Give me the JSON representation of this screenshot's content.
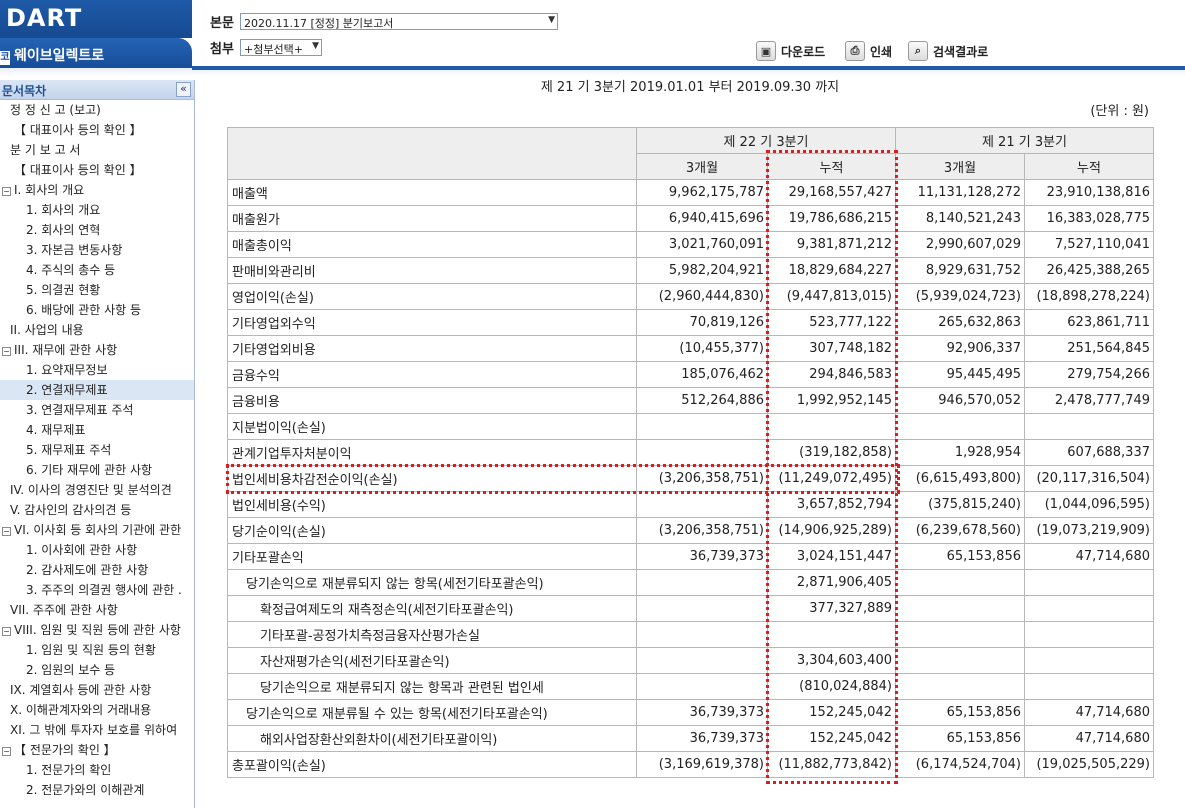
{
  "header": {
    "logo_text": "DART",
    "company_name": "웨이브일렉트로",
    "body_label": "본문",
    "body_select_value": "2020.11.17  [정정] 분기보고서",
    "attach_label": "첨부",
    "attach_select_value": "+첨부선택+",
    "download_label": "다운로드",
    "print_label": "인쇄",
    "search_results_label": "검색결과로"
  },
  "sidebar": {
    "title": "문서목차",
    "items": [
      {
        "label": "정 정 신 고 (보고)",
        "indent": 1,
        "exp": ""
      },
      {
        "label": "【 대표이사 등의 확인 】",
        "indent": 2,
        "exp": ""
      },
      {
        "label": "분 기 보 고 서",
        "indent": 1,
        "exp": ""
      },
      {
        "label": "【 대표이사 등의 확인 】",
        "indent": 2,
        "exp": ""
      },
      {
        "label": "I. 회사의 개요",
        "indent": 0,
        "exp": "−"
      },
      {
        "label": "1. 회사의 개요",
        "indent": 3,
        "exp": ""
      },
      {
        "label": "2. 회사의 연혁",
        "indent": 3,
        "exp": ""
      },
      {
        "label": "3. 자본금 변동사항",
        "indent": 3,
        "exp": ""
      },
      {
        "label": "4. 주식의 총수 등",
        "indent": 3,
        "exp": ""
      },
      {
        "label": "5. 의결권 현황",
        "indent": 3,
        "exp": ""
      },
      {
        "label": "6. 배당에 관한 사항 등",
        "indent": 3,
        "exp": ""
      },
      {
        "label": "II. 사업의 내용",
        "indent": 1,
        "exp": ""
      },
      {
        "label": "III. 재무에 관한 사항",
        "indent": 0,
        "exp": "−"
      },
      {
        "label": "1. 요약재무정보",
        "indent": 3,
        "exp": ""
      },
      {
        "label": "2. 연결재무제표",
        "indent": 3,
        "exp": "",
        "selected": true
      },
      {
        "label": "3. 연결재무제표 주석",
        "indent": 3,
        "exp": ""
      },
      {
        "label": "4. 재무제표",
        "indent": 3,
        "exp": ""
      },
      {
        "label": "5. 재무제표 주석",
        "indent": 3,
        "exp": ""
      },
      {
        "label": "6. 기타 재무에 관한 사항",
        "indent": 3,
        "exp": ""
      },
      {
        "label": "IV. 이사의 경영진단 및 분석의견",
        "indent": 1,
        "exp": ""
      },
      {
        "label": "V. 감사인의 감사의견 등",
        "indent": 1,
        "exp": ""
      },
      {
        "label": "VI. 이사회 등 회사의 기관에 관한",
        "indent": 0,
        "exp": "−"
      },
      {
        "label": "1. 이사회에 관한 사항",
        "indent": 3,
        "exp": ""
      },
      {
        "label": "2. 감사제도에 관한 사항",
        "indent": 3,
        "exp": ""
      },
      {
        "label": "3. 주주의 의결권 행사에 관한 .",
        "indent": 3,
        "exp": ""
      },
      {
        "label": "VII. 주주에 관한 사항",
        "indent": 1,
        "exp": ""
      },
      {
        "label": "VIII. 임원 및 직원 등에 관한 사항",
        "indent": 0,
        "exp": "−"
      },
      {
        "label": "1. 임원 및 직원 등의 현황",
        "indent": 3,
        "exp": ""
      },
      {
        "label": "2. 임원의 보수 등",
        "indent": 3,
        "exp": ""
      },
      {
        "label": "IX. 계열회사 등에 관한 사항",
        "indent": 1,
        "exp": ""
      },
      {
        "label": "X. 이해관계자와의 거래내용",
        "indent": 1,
        "exp": ""
      },
      {
        "label": "XI. 그 밖에 투자자 보호를 위하여",
        "indent": 1,
        "exp": ""
      },
      {
        "label": "【 전문가의 확인 】",
        "indent": 0,
        "exp": "−"
      },
      {
        "label": "1. 전문가의 확인",
        "indent": 3,
        "exp": ""
      },
      {
        "label": "2. 전문가와의 이해관계",
        "indent": 3,
        "exp": ""
      }
    ]
  },
  "main": {
    "period_text": "제 21 기 3분기 2019.01.01 부터 2019.09.30 까지",
    "unit_text": "(단위 : 원)",
    "table": {
      "group_headers": [
        "제 22 기 3분기",
        "제 21 기 3분기"
      ],
      "sub_headers": [
        "3개월",
        "누적",
        "3개월",
        "누적"
      ],
      "rows": [
        {
          "label": "매출액",
          "indent": 0,
          "values": [
            "9,962,175,787",
            "29,168,557,427",
            "11,131,128,272",
            "23,910,138,816"
          ]
        },
        {
          "label": "매출원가",
          "indent": 0,
          "values": [
            "6,940,415,696",
            "19,786,686,215",
            "8,140,521,243",
            "16,383,028,775"
          ]
        },
        {
          "label": "매출총이익",
          "indent": 0,
          "values": [
            "3,021,760,091",
            "9,381,871,212",
            "2,990,607,029",
            "7,527,110,041"
          ]
        },
        {
          "label": "판매비와관리비",
          "indent": 0,
          "values": [
            "5,982,204,921",
            "18,829,684,227",
            "8,929,631,752",
            "26,425,388,265"
          ]
        },
        {
          "label": "영업이익(손실)",
          "indent": 0,
          "values": [
            "(2,960,444,830)",
            "(9,447,813,015)",
            "(5,939,024,723)",
            "(18,898,278,224)"
          ]
        },
        {
          "label": "기타영업외수익",
          "indent": 0,
          "values": [
            "70,819,126",
            "523,777,122",
            "265,632,863",
            "623,861,711"
          ]
        },
        {
          "label": "기타영업외비용",
          "indent": 0,
          "values": [
            "(10,455,377)",
            "307,748,182",
            "92,906,337",
            "251,564,845"
          ]
        },
        {
          "label": "금융수익",
          "indent": 0,
          "values": [
            "185,076,462",
            "294,846,583",
            "95,445,495",
            "279,754,266"
          ]
        },
        {
          "label": "금융비용",
          "indent": 0,
          "values": [
            "512,264,886",
            "1,992,952,145",
            "946,570,052",
            "2,478,777,749"
          ]
        },
        {
          "label": "지분법이익(손실)",
          "indent": 0,
          "values": [
            "",
            "",
            "",
            ""
          ]
        },
        {
          "label": "관계기업투자처분이익",
          "indent": 0,
          "values": [
            "",
            "(319,182,858)",
            "1,928,954",
            "607,688,337"
          ]
        },
        {
          "label": "법인세비용차감전순이익(손실)",
          "indent": 0,
          "values": [
            "(3,206,358,751)",
            "(11,249,072,495)",
            "(6,615,493,800)",
            "(20,117,316,504)"
          ]
        },
        {
          "label": "법인세비용(수익)",
          "indent": 0,
          "values": [
            "",
            "3,657,852,794",
            "(375,815,240)",
            "(1,044,096,595)"
          ]
        },
        {
          "label": "당기순이익(손실)",
          "indent": 0,
          "values": [
            "(3,206,358,751)",
            "(14,906,925,289)",
            "(6,239,678,560)",
            "(19,073,219,909)"
          ]
        },
        {
          "label": "기타포괄손익",
          "indent": 0,
          "values": [
            "36,739,373",
            "3,024,151,447",
            "65,153,856",
            "47,714,680"
          ]
        },
        {
          "label": "당기손익으로 재분류되지 않는 항목(세전기타포괄손익)",
          "indent": 1,
          "values": [
            "",
            "2,871,906,405",
            "",
            ""
          ]
        },
        {
          "label": "확정급여제도의 재측정손익(세전기타포괄손익)",
          "indent": 2,
          "values": [
            "",
            "377,327,889",
            "",
            ""
          ]
        },
        {
          "label": "기타포괄-공정가치측정금융자산평가손실",
          "indent": 2,
          "values": [
            "",
            "",
            "",
            ""
          ]
        },
        {
          "label": "자산재평가손익(세전기타포괄손익)",
          "indent": 2,
          "values": [
            "",
            "3,304,603,400",
            "",
            ""
          ]
        },
        {
          "label": "당기손익으로 재분류되지 않는 항목과 관련된 법인세",
          "indent": 2,
          "values": [
            "",
            "(810,024,884)",
            "",
            ""
          ]
        },
        {
          "label": "당기손익으로 재분류될 수 있는 항목(세전기타포괄손익)",
          "indent": 1,
          "values": [
            "36,739,373",
            "152,245,042",
            "65,153,856",
            "47,714,680"
          ]
        },
        {
          "label": "해외사업장환산외환차이(세전기타포괄이익)",
          "indent": 2,
          "values": [
            "36,739,373",
            "152,245,042",
            "65,153,856",
            "47,714,680"
          ]
        },
        {
          "label": "총포괄이익(손실)",
          "indent": 0,
          "values": [
            "(3,169,619,378)",
            "(11,882,773,842)",
            "(6,174,524,704)",
            "(19,025,505,229)"
          ]
        }
      ]
    },
    "highlight_color": "#d81e1e"
  }
}
